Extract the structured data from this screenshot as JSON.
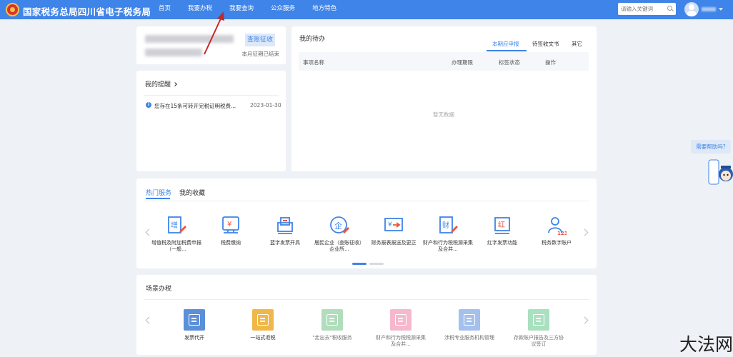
{
  "header": {
    "site_title": "国家税务总局四川省电子税务局",
    "nav": [
      "首页",
      "我要办税",
      "我要查询",
      "公众服务",
      "地方特色"
    ],
    "search_placeholder": "请输入关键词"
  },
  "account": {
    "levy_button": "查账征收",
    "levy_status": "本月征期已结束"
  },
  "reminders": {
    "title": "我的提醒",
    "items": [
      {
        "text": "您存在15条可转开完税证明税费...",
        "date": "2023-01-30"
      }
    ]
  },
  "todo": {
    "title": "我的待办",
    "tabs": [
      "本期应申报",
      "待签收文书",
      "其它"
    ],
    "columns": [
      "事项名称",
      "办理期限",
      "标签状态",
      "操作"
    ],
    "empty_text": "暂无数据"
  },
  "services": {
    "tabs": [
      "热门服务",
      "我的收藏"
    ],
    "items": [
      {
        "icon": "vat-declare-icon",
        "label": "增值税及附加税费申报（一般..."
      },
      {
        "icon": "tax-payment-icon",
        "label": "税费缴纳"
      },
      {
        "icon": "invoice-issue-icon",
        "label": "蓝字发票开具"
      },
      {
        "icon": "enterprise-icon",
        "label": "居民企业（查账征收）企业所..."
      },
      {
        "icon": "financial-report-icon",
        "label": "财务报表报送及更正"
      },
      {
        "icon": "property-tax-icon",
        "label": "财产和行为税税源采集及合并..."
      },
      {
        "icon": "red-invoice-icon",
        "label": "红字发票功能"
      },
      {
        "icon": "digital-account-icon",
        "label": "税务数字账户"
      }
    ]
  },
  "scenes": {
    "title": "场景办税",
    "items": [
      {
        "label": "发票代开",
        "color": "#5b8fd9",
        "icon": "invoice-agent-icon"
      },
      {
        "label": "一站式退税",
        "color": "#f0b84a",
        "icon": "refund-icon"
      },
      {
        "label": "\"走出去\"税收服务",
        "color": "#8fcf9f",
        "icon": "go-global-icon"
      },
      {
        "label": "财产和行为税税源采集及合并...",
        "color": "#f29bb8",
        "icon": "property-scene-icon"
      },
      {
        "label": "涉税专业服务机构管理",
        "color": "#7ea6e6",
        "icon": "agency-icon"
      },
      {
        "label": "存款账户报告及三方协议签订",
        "color": "#86d3a4",
        "icon": "bank-account-icon"
      }
    ]
  },
  "help_text": "需要帮助吗?",
  "watermark": "大法网"
}
